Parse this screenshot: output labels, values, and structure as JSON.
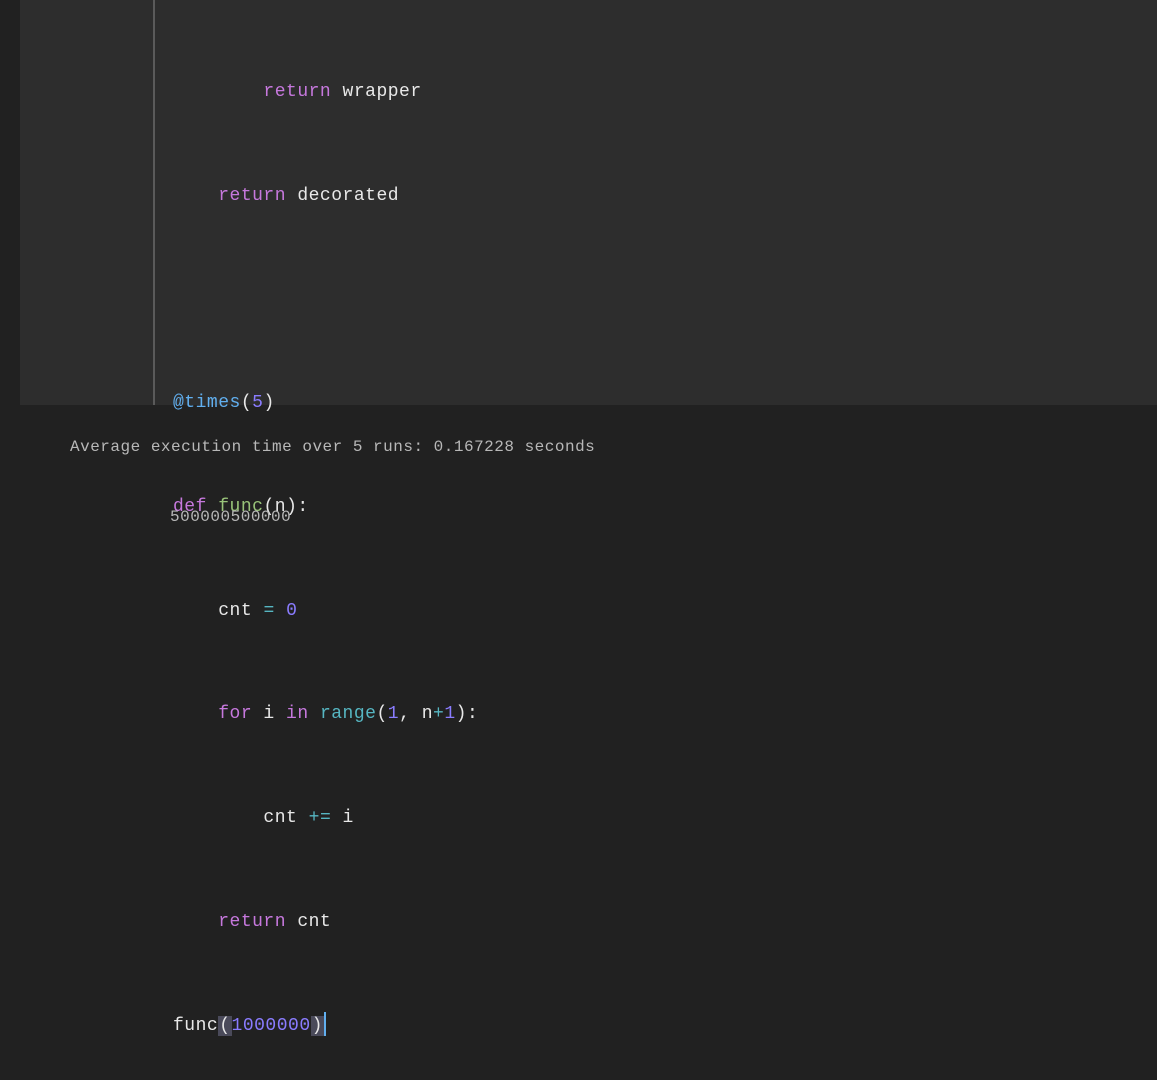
{
  "code": {
    "line1": {
      "indent": "        ",
      "return": "return",
      "wrapper": " wrapper"
    },
    "line2": {
      "indent": "    ",
      "return": "return",
      "decorated": " decorated"
    },
    "line4": {
      "decorator": "@times",
      "open": "(",
      "num": "5",
      "close": ")"
    },
    "line5": {
      "def": "def",
      "space": " ",
      "name": "func",
      "open": "(",
      "param": "n",
      "close": ")",
      "colon": ":"
    },
    "line6": {
      "indent": "    ",
      "var": "cnt ",
      "op": "=",
      "space": " ",
      "val": "0"
    },
    "line7": {
      "indent": "    ",
      "for": "for",
      "ivar": " i ",
      "in": "in",
      "space": " ",
      "range": "range",
      "open": "(",
      "one": "1",
      "comma": ", n",
      "plus": "+",
      "one2": "1",
      "close": ")",
      "colon": ":"
    },
    "line8": {
      "indent": "        ",
      "var": "cnt ",
      "op": "+=",
      "ivar": " i"
    },
    "line9": {
      "indent": "    ",
      "return": "return",
      "var": " cnt"
    },
    "line10": {
      "name": "func",
      "open": "(",
      "num": "1000000",
      "close": ")"
    }
  },
  "output": {
    "line1": "Average execution time over 5 runs: 0.167228 seconds",
    "result": "500000500000"
  }
}
